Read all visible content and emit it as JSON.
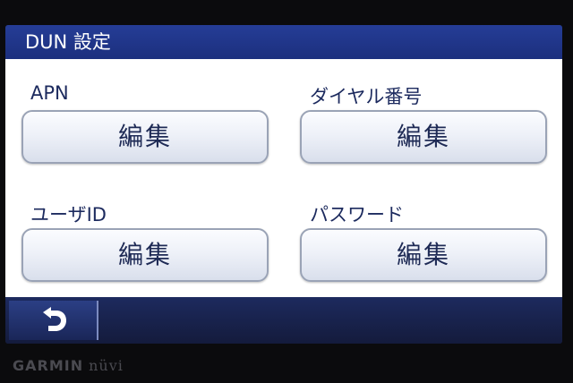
{
  "title": "DUN 設定",
  "fields": [
    {
      "label": "APN",
      "button": "編集"
    },
    {
      "label": "ダイヤル番号",
      "button": "編集"
    },
    {
      "label": "ユーザID",
      "button": "編集"
    },
    {
      "label": "パスワード",
      "button": "編集"
    }
  ],
  "back_icon": "back-arrow-icon",
  "brand": {
    "name": "GARMIN",
    "model": "nüvi"
  },
  "colors": {
    "titlebar": "#1c2f7e",
    "content_bg": "#ffffff",
    "button_border": "#9aa3b6",
    "label_text": "#1c2a5e",
    "bottombar": "#1a2658"
  }
}
